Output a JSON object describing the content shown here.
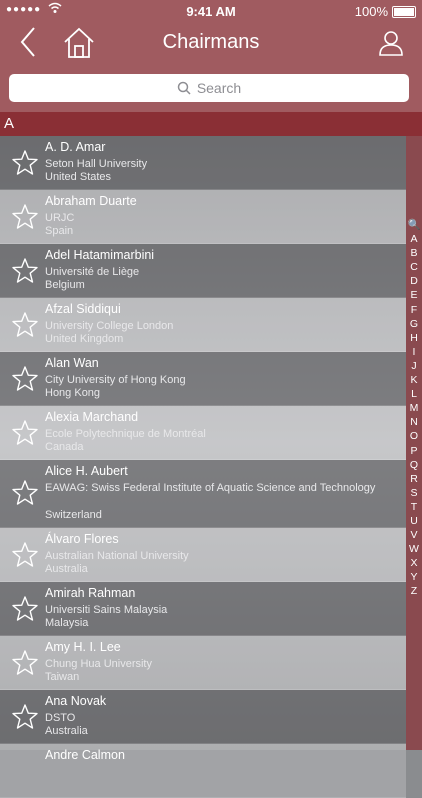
{
  "status_bar": {
    "time": "9:41 AM",
    "battery": "100%",
    "signal": "●●●●●"
  },
  "nav": {
    "title": "Chairmans"
  },
  "search": {
    "placeholder": "Search"
  },
  "section": "A",
  "items": [
    {
      "name": "A. D. Amar",
      "institution": "Seton Hall University",
      "country": "United States"
    },
    {
      "name": "Abraham Duarte",
      "institution": "URJC",
      "country": "Spain"
    },
    {
      "name": "Adel Hatamimarbini",
      "institution": "Université de Liège",
      "country": "Belgium"
    },
    {
      "name": "Afzal Siddiqui",
      "institution": "University College London",
      "country": "United Kingdom"
    },
    {
      "name": "Alan Wan",
      "institution": "City University of Hong Kong",
      "country": "Hong Kong"
    },
    {
      "name": "Alexia Marchand",
      "institution": "Ecole Polytechnique de Montréal",
      "country": "Canada"
    },
    {
      "name": "Alice H. Aubert",
      "institution": "EAWAG: Swiss Federal Institute of Aquatic Science and Technology",
      "country": "Switzerland"
    },
    {
      "name": "Álvaro Flores",
      "institution": "Australian National University",
      "country": "Australia"
    },
    {
      "name": "Amirah Rahman",
      "institution": "Universiti Sains Malaysia",
      "country": "Malaysia"
    },
    {
      "name": "Amy H. I. Lee",
      "institution": "Chung Hua University",
      "country": "Taiwan"
    },
    {
      "name": "Ana Novak",
      "institution": "DSTO",
      "country": "Australia"
    },
    {
      "name": "Andre Calmon",
      "institution": "",
      "country": ""
    }
  ],
  "index": [
    "🔍",
    "A",
    "B",
    "C",
    "D",
    "E",
    "F",
    "G",
    "H",
    "I",
    "J",
    "K",
    "L",
    "M",
    "N",
    "O",
    "P",
    "Q",
    "R",
    "S",
    "T",
    "U",
    "V",
    "W",
    "X",
    "Y",
    "Z"
  ],
  "colors": {
    "nav": "#a05b60",
    "section": "#8a2f35",
    "index_bar": "#8a4a4f"
  }
}
